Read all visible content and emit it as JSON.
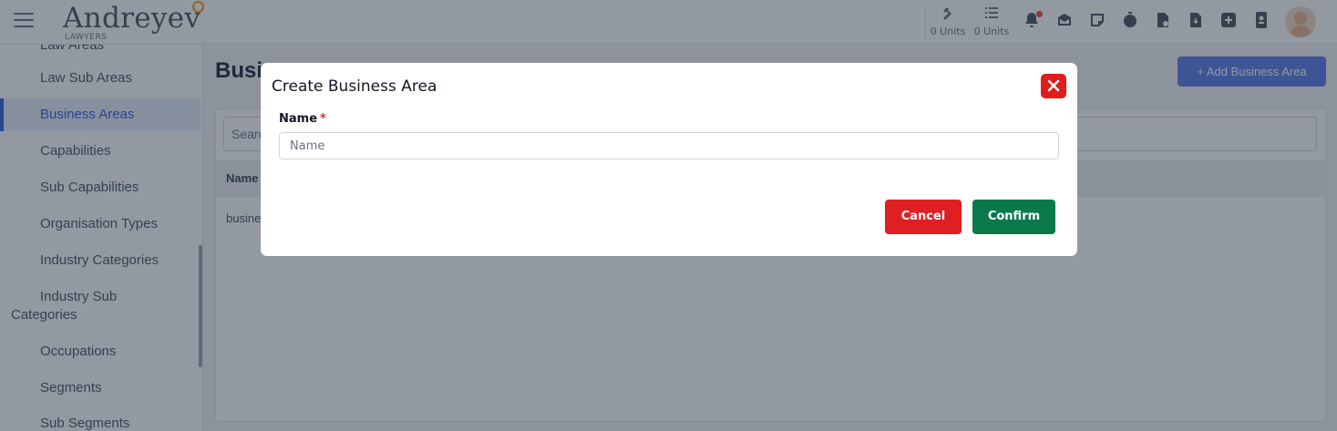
{
  "header": {
    "logo_name": "Andreyev",
    "logo_sub": "LAWYERS",
    "units": [
      {
        "icon": "gavel-icon",
        "label": "0 Units"
      },
      {
        "icon": "list-icon",
        "label": "0 Units"
      }
    ],
    "icons": [
      "bell-icon",
      "inbox-icon",
      "note-icon",
      "stopwatch-icon",
      "document-icon",
      "download-document-icon",
      "plus-square-icon",
      "id-badge-icon"
    ]
  },
  "sidebar": {
    "items": [
      {
        "label": "Law Areas"
      },
      {
        "label": "Law Sub Areas"
      },
      {
        "label": "Business Areas",
        "active": true
      },
      {
        "label": "Capabilities"
      },
      {
        "label": "Sub Capabilities"
      },
      {
        "label": "Organisation Types"
      },
      {
        "label": "Industry Categories"
      },
      {
        "label_line1": "Industry Sub",
        "label_line2": "Categories"
      },
      {
        "label": "Occupations"
      },
      {
        "label": "Segments"
      },
      {
        "label": "Sub Segments"
      }
    ]
  },
  "main": {
    "title": "Busi",
    "add_button": "+ Add Business Area",
    "search_placeholder": "Searc",
    "table_header": "Name",
    "table_row": "busine"
  },
  "modal": {
    "title": "Create Business Area",
    "field_label": "Name",
    "required_mark": "*",
    "input_placeholder": "Name",
    "input_value": "",
    "cancel_label": "Cancel",
    "confirm_label": "Confirm"
  },
  "colors": {
    "overlay": "#1e293b",
    "primary": "#5b7ee6",
    "danger": "#e01f22",
    "success": "#0b7a4b"
  }
}
